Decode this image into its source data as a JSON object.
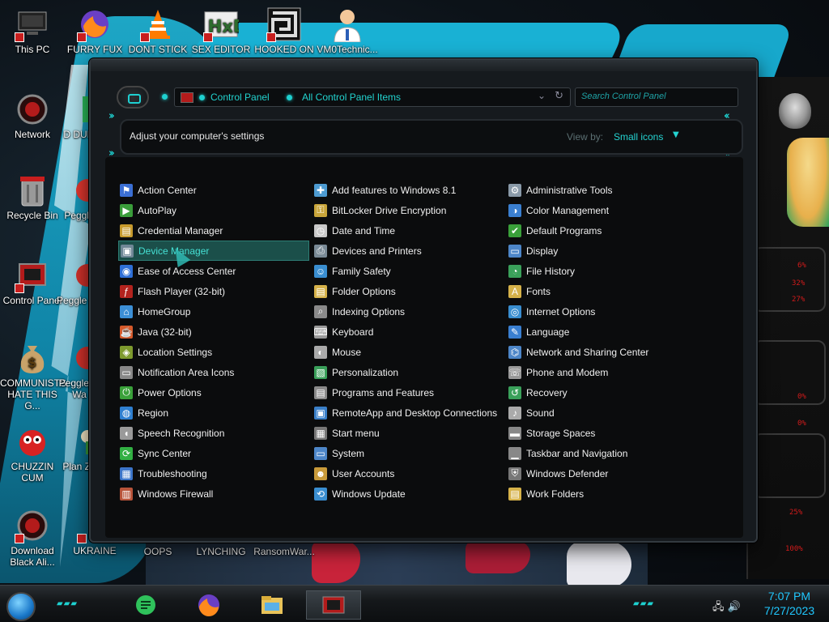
{
  "desktop": {
    "icons": [
      {
        "label": "This PC",
        "icon": "computer-icon"
      },
      {
        "label": "FURRY FUX",
        "icon": "firefox-icon"
      },
      {
        "label": "DONT STICK",
        "icon": "vlc-cone-icon"
      },
      {
        "label": "SEX EDITOR",
        "icon": "hxd-editor-icon"
      },
      {
        "label": "HOOKED ON",
        "icon": "maze-icon"
      },
      {
        "label": "VM0Technic...",
        "icon": "doctor-icon"
      },
      {
        "label": "Network",
        "icon": "network-icon"
      },
      {
        "label": "D DUM",
        "icon": "app-icon"
      },
      {
        "label": "Recycle Bin",
        "icon": "recycle-bin-icon"
      },
      {
        "label": "Peggle",
        "icon": "peggle-icon"
      },
      {
        "label": "Control Panel",
        "icon": "control-panel-icon"
      },
      {
        "label": "Peggle De",
        "icon": "peggle-icon"
      },
      {
        "label": "COMMUNISTS HATE THIS G...",
        "icon": "money-bag-icon"
      },
      {
        "label": "Peggle of Wa",
        "icon": "peggle-icon"
      },
      {
        "label": "CHUZZIN CUM",
        "icon": "chuzzle-icon"
      },
      {
        "label": "Plan Zo",
        "icon": "flower-icon"
      },
      {
        "label": "Download Black Ali...",
        "icon": "alien-icon"
      },
      {
        "label": "UKRAINE",
        "icon": "app-icon"
      },
      {
        "label": "OOPS",
        "icon": "app-icon"
      },
      {
        "label": "LYNCHING",
        "icon": "app-icon"
      },
      {
        "label": "RansomWar...",
        "icon": "app-icon"
      }
    ]
  },
  "window": {
    "breadcrumb": [
      "Control Panel",
      "All Control Panel Items"
    ],
    "search_placeholder": "Search Control Panel",
    "heading": "Adjust your computer's settings",
    "view_by_label": "View by:",
    "view_by_value": "Small icons",
    "columns": [
      [
        {
          "label": "Action Center",
          "icon": "flag-icon",
          "color": "#3b6fd4"
        },
        {
          "label": "AutoPlay",
          "icon": "autoplay-icon",
          "color": "#3a9d3a"
        },
        {
          "label": "Credential Manager",
          "icon": "credential-icon",
          "color": "#c79b2e"
        },
        {
          "label": "Device Manager",
          "icon": "device-manager-icon",
          "color": "#6f8796",
          "selected": true
        },
        {
          "label": "Ease of Access Center",
          "icon": "ease-access-icon",
          "color": "#2f6fd6"
        },
        {
          "label": "Flash Player (32-bit)",
          "icon": "flash-icon",
          "color": "#b3231e"
        },
        {
          "label": "HomeGroup",
          "icon": "homegroup-icon",
          "color": "#3c8fd6"
        },
        {
          "label": "Java (32-bit)",
          "icon": "java-icon",
          "color": "#d65a2b"
        },
        {
          "label": "Location Settings",
          "icon": "location-icon",
          "color": "#7e9a2e"
        },
        {
          "label": "Notification Area Icons",
          "icon": "notification-icon",
          "color": "#888888"
        },
        {
          "label": "Power Options",
          "icon": "power-icon",
          "color": "#3aa13a"
        },
        {
          "label": "Region",
          "icon": "region-icon",
          "color": "#2f7fd0"
        },
        {
          "label": "Speech Recognition",
          "icon": "microphone-icon",
          "color": "#9a9a9a"
        },
        {
          "label": "Sync Center",
          "icon": "sync-icon",
          "color": "#32b043"
        },
        {
          "label": "Troubleshooting",
          "icon": "troubleshoot-icon",
          "color": "#3c75c9"
        },
        {
          "label": "Windows Firewall",
          "icon": "firewall-icon",
          "color": "#b8543a"
        }
      ],
      [
        {
          "label": "Add features to Windows 8.1",
          "icon": "add-features-icon",
          "color": "#4d9bd1"
        },
        {
          "label": "BitLocker Drive Encryption",
          "icon": "bitlocker-icon",
          "color": "#c8a53a"
        },
        {
          "label": "Date and Time",
          "icon": "clock-icon",
          "color": "#c9c9c9"
        },
        {
          "label": "Devices and Printers",
          "icon": "printer-icon",
          "color": "#7a8a96"
        },
        {
          "label": "Family Safety",
          "icon": "family-icon",
          "color": "#3a8ed0"
        },
        {
          "label": "Folder Options",
          "icon": "folder-options-icon",
          "color": "#d6b24a"
        },
        {
          "label": "Indexing Options",
          "icon": "indexing-icon",
          "color": "#8a8a8a"
        },
        {
          "label": "Keyboard",
          "icon": "keyboard-icon",
          "color": "#999999"
        },
        {
          "label": "Mouse",
          "icon": "mouse-icon",
          "color": "#aaaaaa"
        },
        {
          "label": "Personalization",
          "icon": "personalization-icon",
          "color": "#3aa05a"
        },
        {
          "label": "Programs and Features",
          "icon": "programs-icon",
          "color": "#8a8a8a"
        },
        {
          "label": "RemoteApp and Desktop Connections",
          "icon": "remoteapp-icon",
          "color": "#3a7fc8"
        },
        {
          "label": "Start menu",
          "icon": "start-menu-icon",
          "color": "#777777"
        },
        {
          "label": "System",
          "icon": "system-icon",
          "color": "#4d86c8"
        },
        {
          "label": "User Accounts",
          "icon": "user-accounts-icon",
          "color": "#c89a3a"
        },
        {
          "label": "Windows Update",
          "icon": "windows-update-icon",
          "color": "#3a8ed0"
        }
      ],
      [
        {
          "label": "Administrative Tools",
          "icon": "admin-tools-icon",
          "color": "#8a9aa8"
        },
        {
          "label": "Color Management",
          "icon": "color-management-icon",
          "color": "#3a7fd0"
        },
        {
          "label": "Default Programs",
          "icon": "default-programs-icon",
          "color": "#3aa03a"
        },
        {
          "label": "Display",
          "icon": "display-icon",
          "color": "#4d86c8"
        },
        {
          "label": "File History",
          "icon": "file-history-icon",
          "color": "#3aa05a"
        },
        {
          "label": "Fonts",
          "icon": "fonts-icon",
          "color": "#d6b24a"
        },
        {
          "label": "Internet Options",
          "icon": "internet-options-icon",
          "color": "#3a8ed0"
        },
        {
          "label": "Language",
          "icon": "language-icon",
          "color": "#3a7fd0"
        },
        {
          "label": "Network and Sharing Center",
          "icon": "network-sharing-icon",
          "color": "#4d86c8"
        },
        {
          "label": "Phone and Modem",
          "icon": "phone-icon",
          "color": "#999999"
        },
        {
          "label": "Recovery",
          "icon": "recovery-icon",
          "color": "#3aa05a"
        },
        {
          "label": "Sound",
          "icon": "sound-icon",
          "color": "#aaaaaa"
        },
        {
          "label": "Storage Spaces",
          "icon": "storage-icon",
          "color": "#888888"
        },
        {
          "label": "Taskbar and Navigation",
          "icon": "taskbar-icon",
          "color": "#888888"
        },
        {
          "label": "Windows Defender",
          "icon": "defender-icon",
          "color": "#777777"
        },
        {
          "label": "Work Folders",
          "icon": "work-folders-icon",
          "color": "#d6b24a"
        }
      ]
    ]
  },
  "gadget": {
    "stats": [
      "6%",
      "32%",
      "27%",
      "0%",
      "0%",
      "25%",
      "100%"
    ]
  },
  "taskbar": {
    "apps": [
      {
        "name": "green-app-icon",
        "active": false
      },
      {
        "name": "firefox-icon",
        "active": false
      },
      {
        "name": "file-explorer-icon",
        "active": false
      },
      {
        "name": "control-panel-icon",
        "active": true
      }
    ],
    "time": "7:07 PM",
    "date": "7/27/2023"
  },
  "colors": {
    "accent": "#1ed0cf",
    "window_bg": "#161a1e",
    "selection": "#1b4f4a"
  }
}
